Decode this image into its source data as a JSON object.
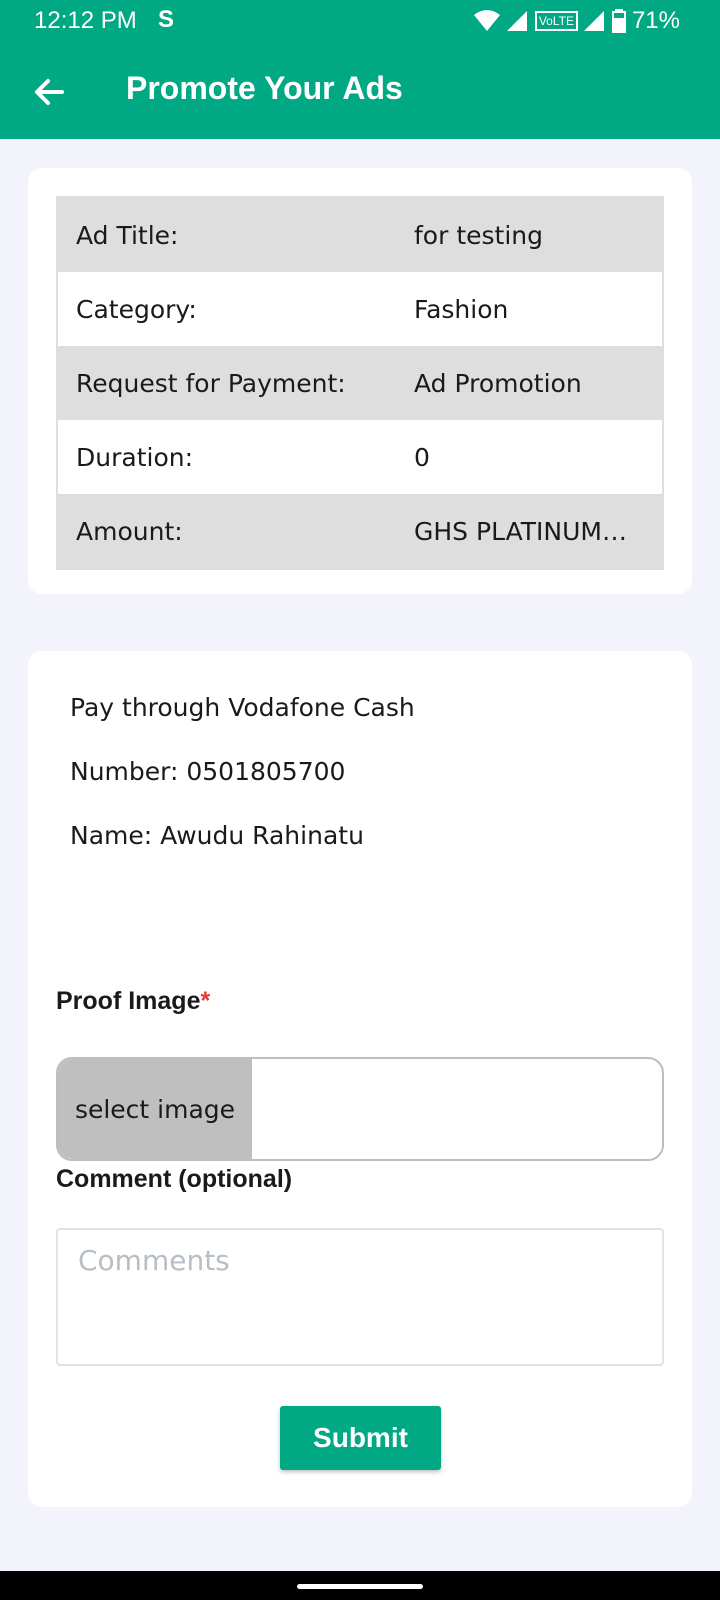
{
  "status_bar": {
    "time": "12:12 PM",
    "app_indicator": "S",
    "network_badge": "VoLTE",
    "battery": "71%",
    "icons": [
      "wifi-icon",
      "signal-icon",
      "battery-icon"
    ]
  },
  "app_bar": {
    "title": "Promote Your Ads",
    "back_icon": "arrow-left-icon",
    "color": "#00a884"
  },
  "ad_details": {
    "rows": [
      {
        "label": "Ad Title:",
        "value": "for testing"
      },
      {
        "label": "Category:",
        "value": "Fashion"
      },
      {
        "label": "Request for Payment:",
        "value": "Ad Promotion"
      },
      {
        "label": "Duration:",
        "value": "0"
      },
      {
        "label": "Amount:",
        "value": "GHS PLATINUM+..."
      }
    ]
  },
  "payment": {
    "pay_through": "Pay through  Vodafone Cash",
    "number": "Number: 0501805700",
    "name": "Name: Awudu Rahinatu"
  },
  "form": {
    "proof_label": "Proof Image",
    "required_mark": "*",
    "select_image": "select image",
    "comment_label": "Comment (optional)",
    "comment_placeholder": "Comments",
    "submit": "Submit"
  }
}
